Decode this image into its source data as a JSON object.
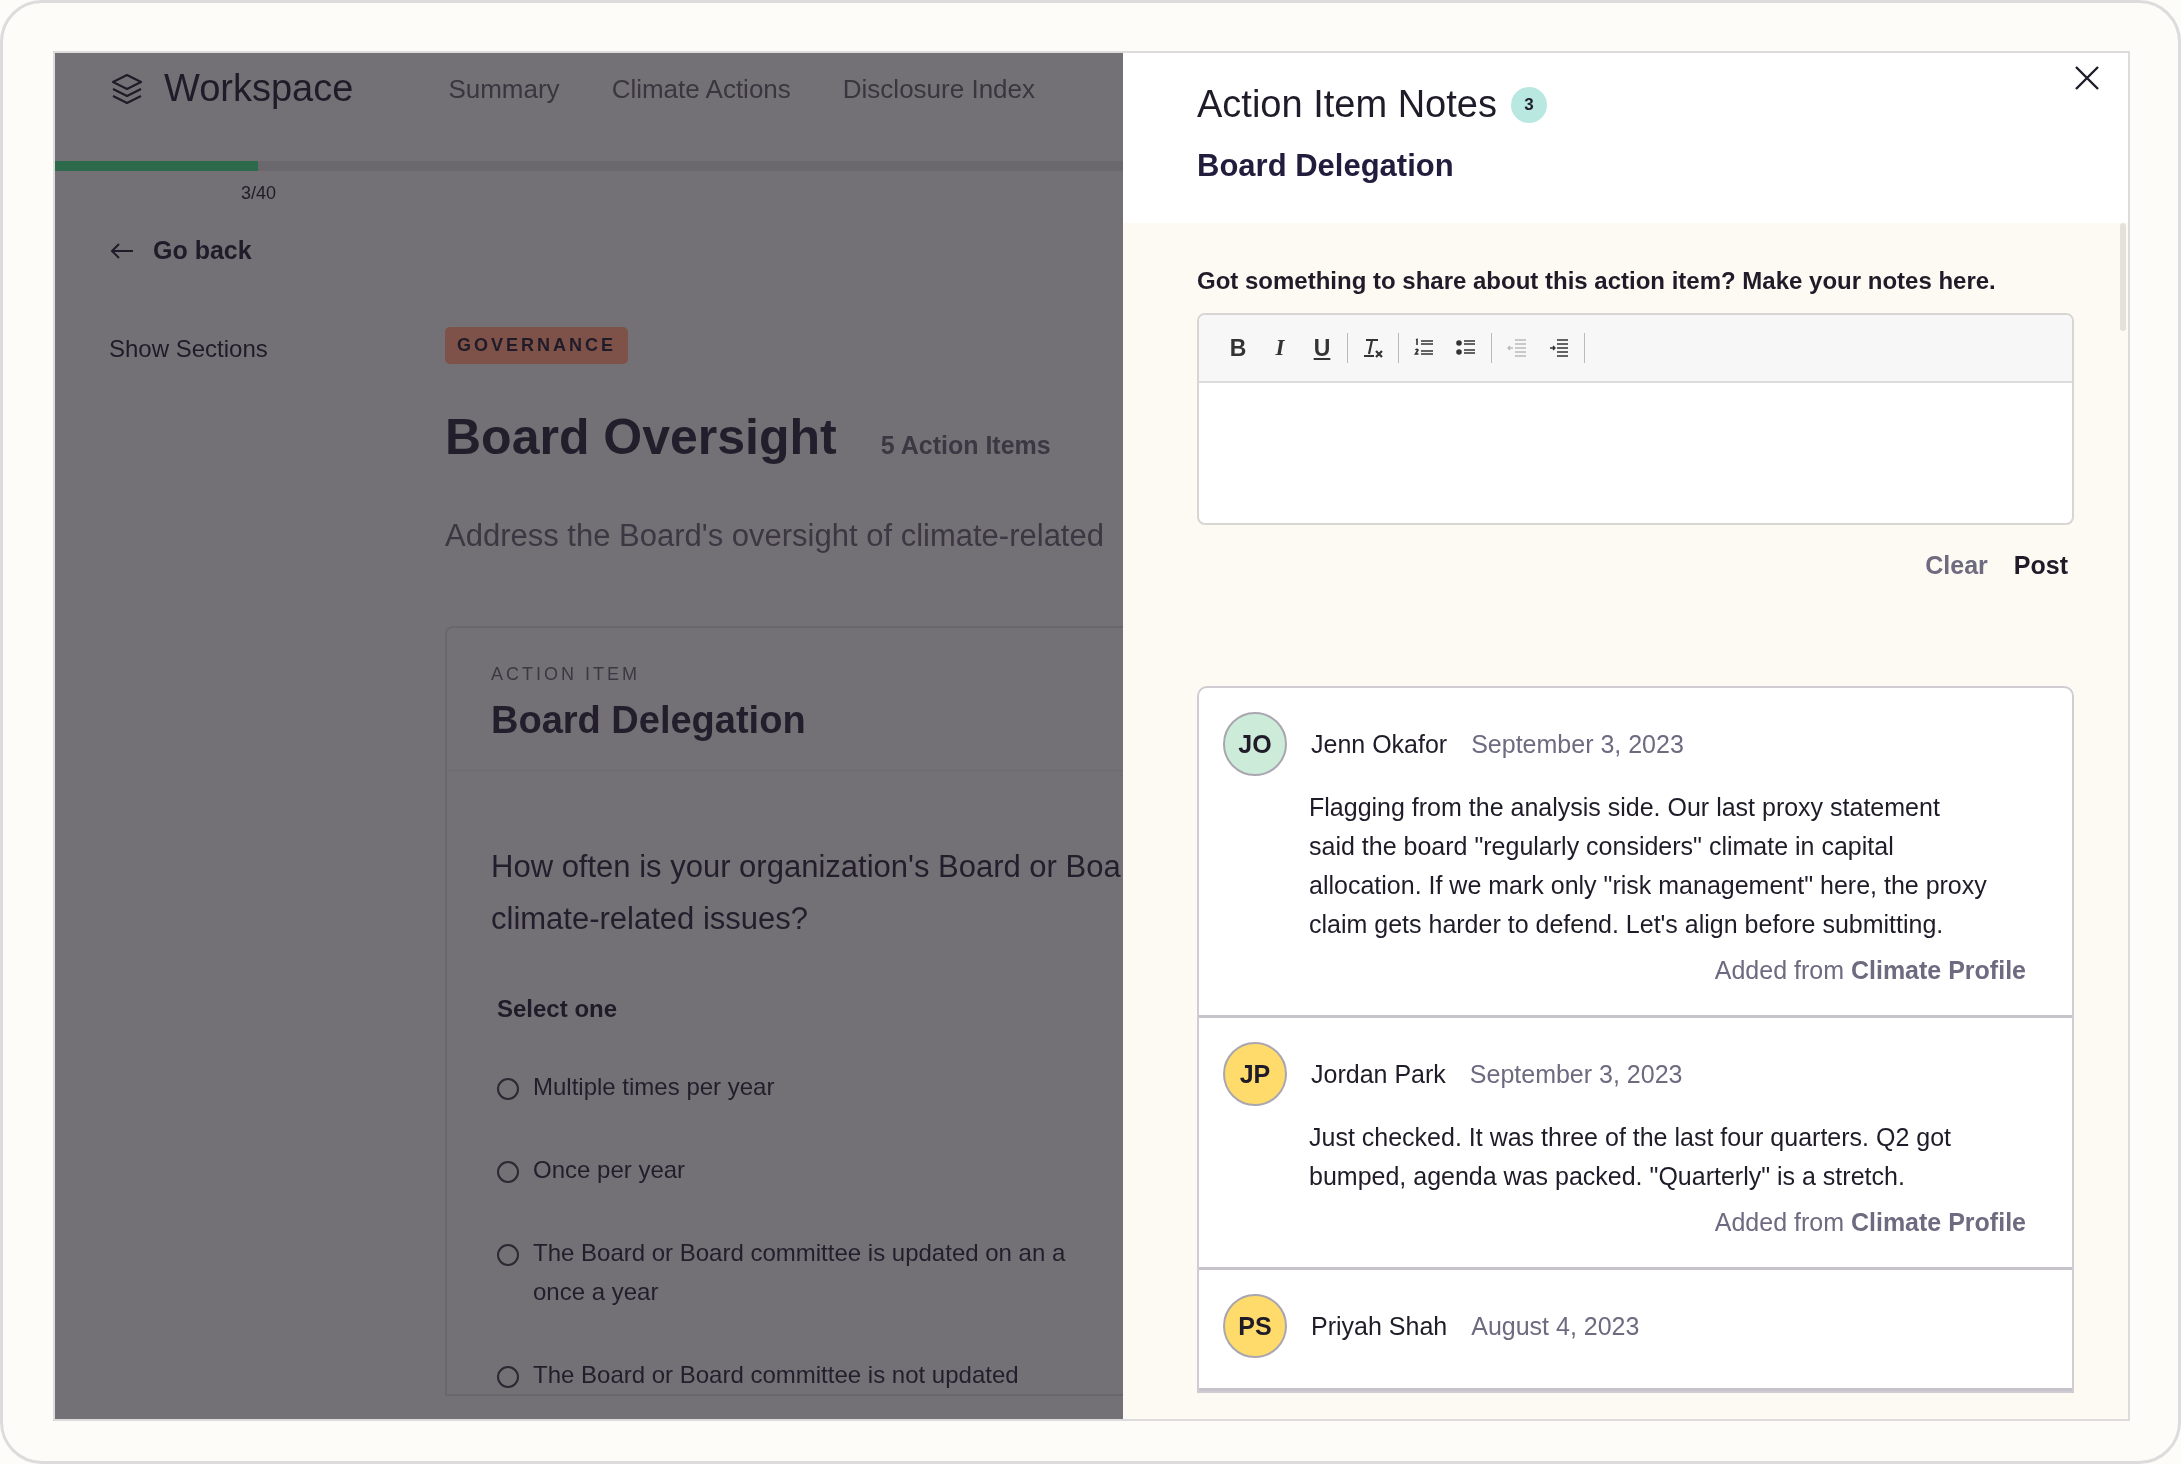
{
  "app": {
    "name": "Workspace"
  },
  "nav": [
    "Summary",
    "Climate Actions",
    "Disclosure Index"
  ],
  "progress": {
    "level": 0.19,
    "label": "3/40"
  },
  "back_link": "Go back",
  "sidebar_toggle": "Show Sections",
  "section": {
    "tag": "GOVERNANCE",
    "title": "Board Oversight",
    "count": "5 Action Items",
    "description": "Address the Board's oversight of climate-related"
  },
  "action_item": {
    "eyebrow": "ACTION ITEM",
    "title": "Board Delegation",
    "question_lines": [
      "How often is your organization's Board or Boa",
      "climate-related issues?"
    ],
    "prompt": "Select one",
    "options": [
      {
        "lines": [
          "Multiple times per year"
        ],
        "selected": false
      },
      {
        "lines": [
          "Once per year"
        ],
        "selected": false
      },
      {
        "lines": [
          "The Board or Board committee is updated on an a",
          "once a year"
        ],
        "selected": false
      },
      {
        "lines": [
          "The Board or Board committee is not updated"
        ],
        "selected": false
      }
    ]
  },
  "notes_panel": {
    "title": "Action Item Notes",
    "count": "3",
    "subtitle": "Board Delegation",
    "prompt": "Got something to share about this action item? Make your notes here.",
    "toolbar": [
      {
        "kind": "bold",
        "label": "B",
        "disabled": false
      },
      {
        "kind": "italic",
        "label": "I",
        "disabled": false
      },
      {
        "kind": "underline",
        "label": "U",
        "disabled": false
      },
      {
        "kind": "clear-format",
        "disabled": false
      },
      {
        "kind": "numbered-list",
        "disabled": false
      },
      {
        "kind": "bulleted-list",
        "disabled": false
      },
      {
        "kind": "outdent",
        "disabled": true
      },
      {
        "kind": "indent",
        "disabled": false
      }
    ],
    "buttons": [
      "Clear",
      "Post"
    ],
    "comments": [
      {
        "initials": "JO",
        "color": "#cdebd9",
        "author": "Jenn Okafor",
        "date": "September 3, 2023",
        "body": "Flagging from the analysis side. Our last proxy statement said the board \"regularly considers\" climate in capital allocation. If we mark only \"risk management\" here, the proxy claim gets harder to defend. Let's align before submitting.",
        "source": "Added from **Climate Profile**"
      },
      {
        "initials": "JP",
        "color": "#fedb6b",
        "author": "Jordan Park",
        "date": "September 3, 2023",
        "body": "Just checked. It was three of the last four quarters. Q2 got bumped, agenda was packed. \"Quarterly\" is a stretch.",
        "source": "Added from **Climate Profile**"
      },
      {
        "initials": "PS",
        "color": "#fedb6b",
        "author": "Priyah Shah",
        "date": "August 4, 2023"
      }
    ]
  }
}
